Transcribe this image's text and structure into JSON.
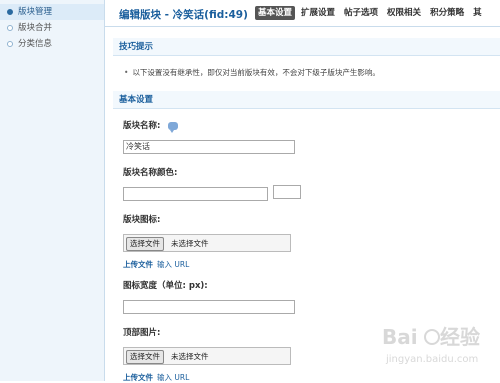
{
  "sidebar": {
    "items": [
      {
        "label": "版块管理",
        "active": true
      },
      {
        "label": "版块合并",
        "active": false
      },
      {
        "label": "分类信息",
        "active": false
      }
    ]
  },
  "header": {
    "title": "编辑版块 - 冷笑话(fid:49)",
    "tabs": [
      "基本设置",
      "扩展设置",
      "帖子选项",
      "权限相关",
      "积分策略",
      "其"
    ],
    "active_tab": "基本设置"
  },
  "tips": {
    "heading": "技巧提示",
    "bullet": "•",
    "text": "以下设置没有继承性，即仅对当前版块有效，不会对下级子版块产生影响。"
  },
  "basic": {
    "heading": "基本设置",
    "name_label": "版块名称:",
    "name_value": "冷笑话",
    "name_color_label": "版块名称颜色:",
    "name_color_value": "",
    "icon_label": "版块图标:",
    "file_button": "选择文件",
    "file_status": "未选择文件",
    "upload_link": "上传文件",
    "url_link": "输入 URL",
    "icon_width_label": "图标宽度（单位: px):",
    "icon_width_value": "",
    "banner_label": "顶部图片:"
  },
  "colors": {
    "accent": "#1b5f9d",
    "sidebar_bg": "#eef5fb",
    "section_bg": "#f2f8fd"
  },
  "watermark": {
    "text": "Baidu经验",
    "url": "jingyan.baidu.com"
  }
}
